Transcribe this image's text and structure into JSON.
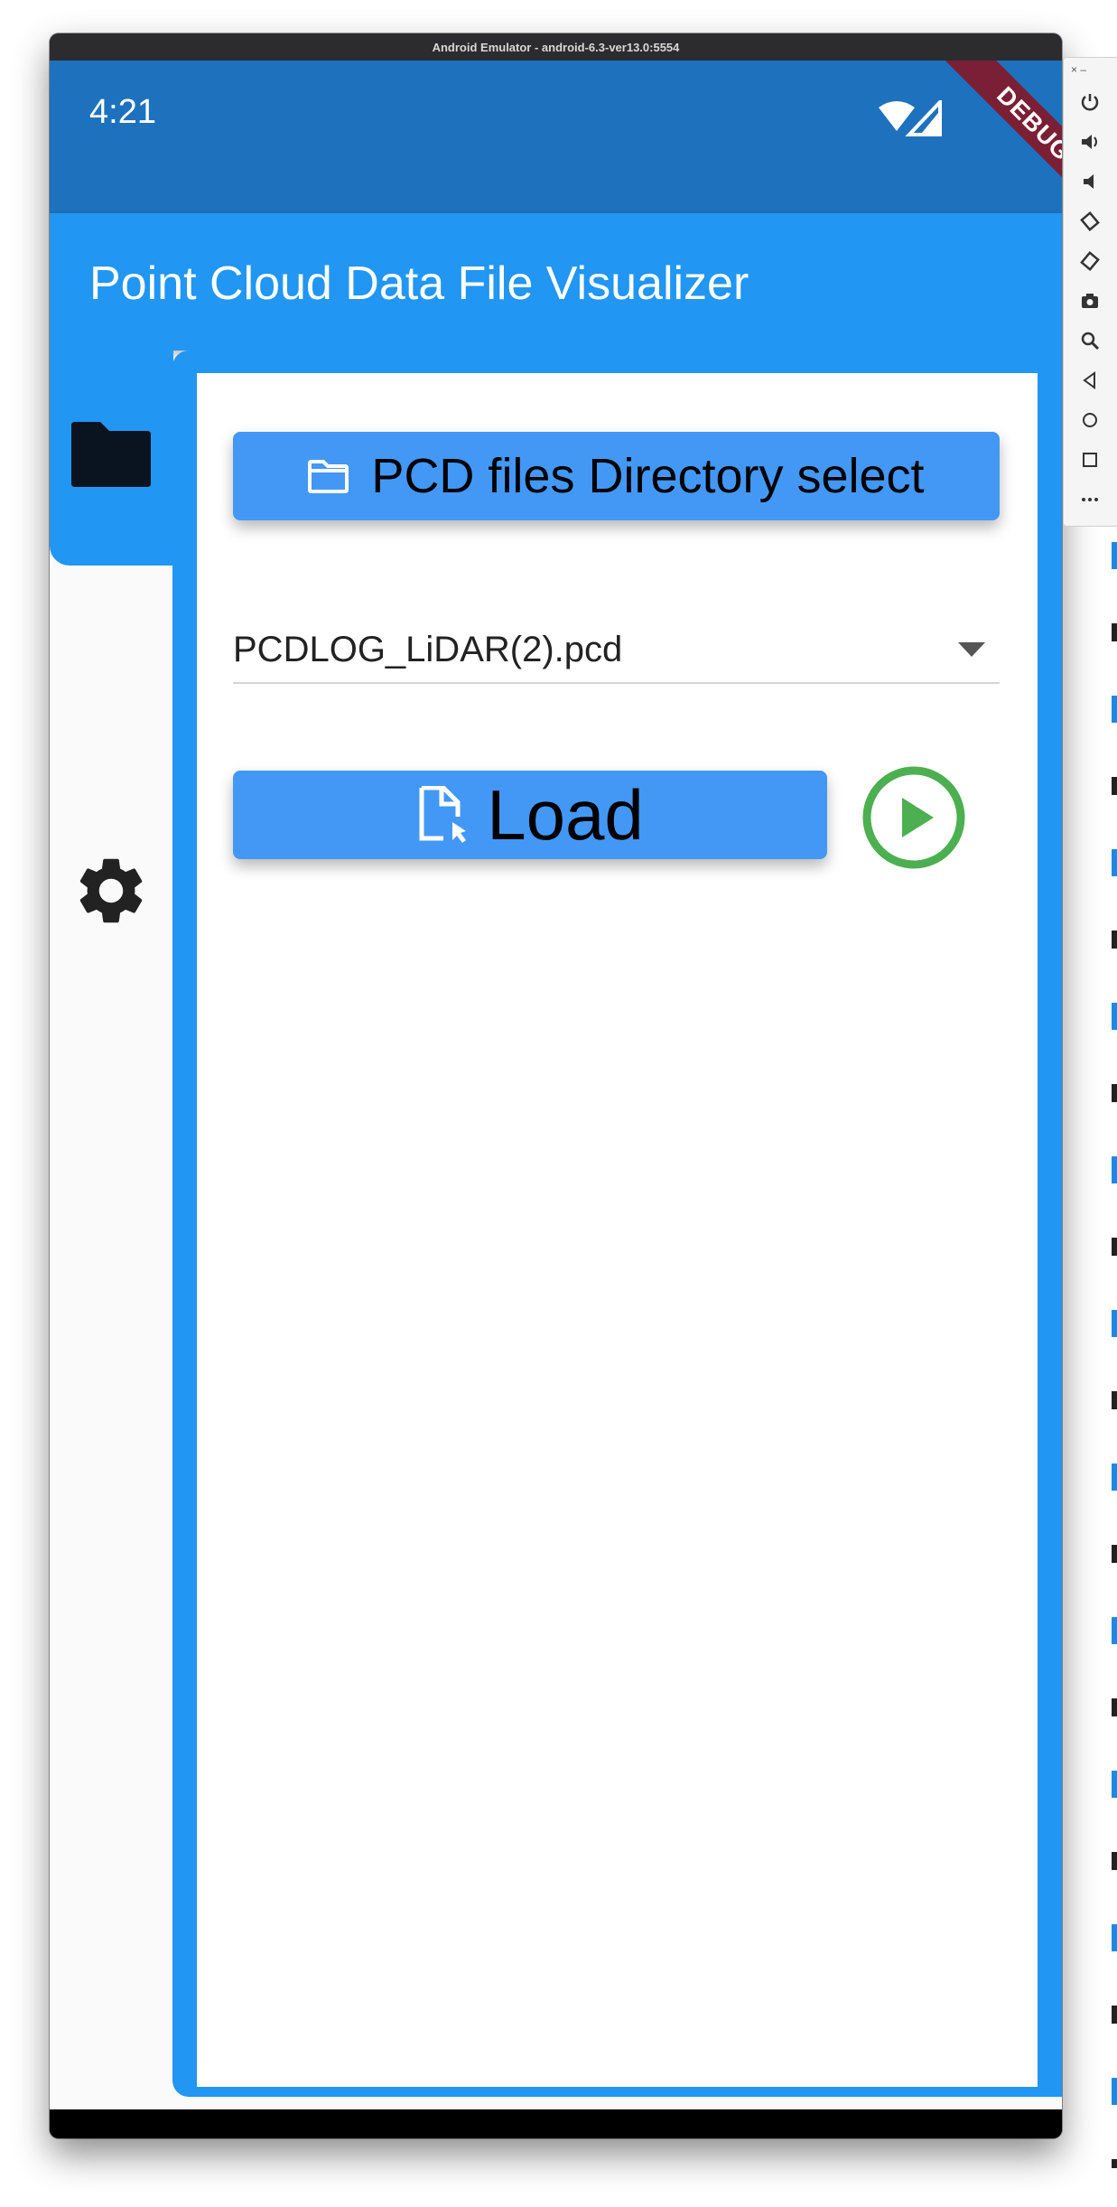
{
  "emulator": {
    "window_title": "Android Emulator - android-6.3-ver13.0:5554"
  },
  "status_bar": {
    "time": "4:21",
    "icons": [
      "wifi-icon",
      "cell-signal-icon"
    ]
  },
  "app_bar": {
    "title": "Point Cloud Data File Visualizer",
    "debug_banner": "DEBUG"
  },
  "navigation_rail": {
    "items": [
      {
        "icon": "folder-icon",
        "selected": true
      },
      {
        "icon": "gear-icon",
        "selected": false
      }
    ]
  },
  "main": {
    "directory_button_label": "PCD files Directory select",
    "file_dropdown": {
      "selected": "PCDLOG_LiDAR(2).pcd"
    },
    "load_button_label": "Load",
    "play_button_icon": "play-circle-icon"
  },
  "side_panel": {
    "top": "× –",
    "buttons": [
      "power-icon",
      "volume-up-icon",
      "volume-down-icon",
      "rotate-left-icon",
      "rotate-right-icon",
      "camera-icon",
      "zoom-icon",
      "back-icon",
      "home-icon",
      "overview-icon",
      "more-icon"
    ]
  },
  "colors": {
    "status_bar": "#1e72bd",
    "primary": "#2196f3",
    "button": "#4398f5",
    "play_green": "#4caf50",
    "debug_ribbon": "#7a1f35"
  }
}
